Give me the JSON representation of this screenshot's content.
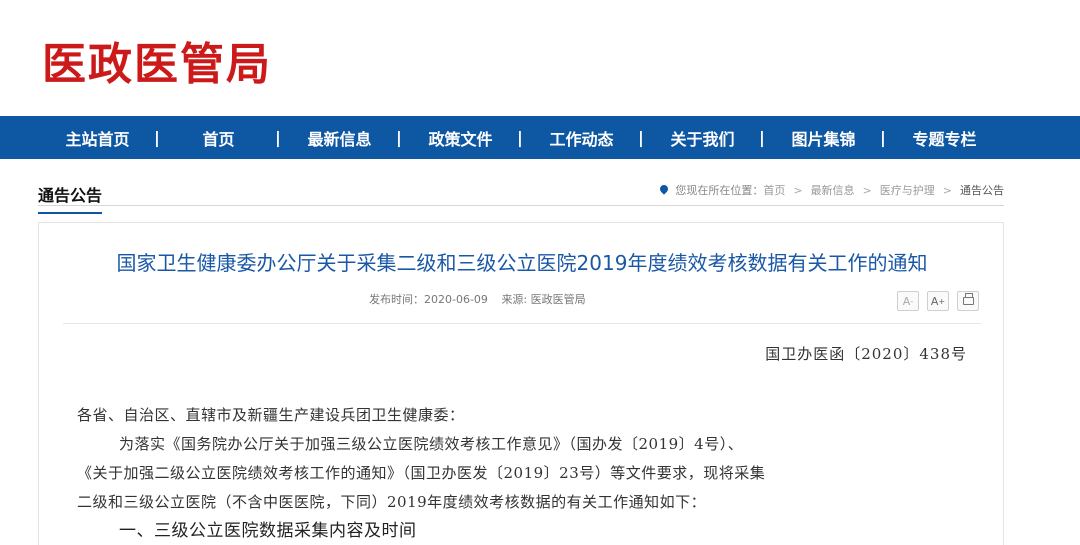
{
  "site": {
    "logo": "医政医管局"
  },
  "nav": {
    "items": [
      "主站首页",
      "首页",
      "最新信息",
      "政策文件",
      "工作动态",
      "关于我们",
      "图片集锦",
      "专题专栏"
    ],
    "separator": "|"
  },
  "section": {
    "title": "通告公告",
    "breadcrumb": {
      "prefix": "您现在所在位置：",
      "items": [
        "首页",
        "最新信息",
        "医疗与护理",
        "通告公告"
      ],
      "separator": ">"
    }
  },
  "article": {
    "title": "国家卫生健康委办公厅关于采集二级和三级公立医院2019年度绩效考核数据有关工作的通知",
    "publish_time": "发布时间：2020-06-09",
    "source": "来源: 医政医管局",
    "tools": {
      "font_smaller": "A",
      "font_larger": "A",
      "print": "print-icon"
    },
    "doc_number": "国卫办医函〔2020〕438号",
    "paragraphs": [
      "各省、自治区、直辖市及新疆生产建设兵团卫生健康委：",
      "为落实《国务院办公厅关于加强三级公立医院绩效考核工作意见》（国办发〔2019〕4号）、",
      "《关于加强二级公立医院绩效考核工作的通知》（国卫办医发〔2019〕23号）等文件要求，现将采集",
      "二级和三级公立医院（不含中医医院，下同）2019年度绩效考核数据的有关工作通知如下：",
      "一、三级公立医院数据采集内容及时间"
    ]
  },
  "colors": {
    "nav_bg": "#0e57a3",
    "logo": "#cc1a1a",
    "title": "#1a58a7"
  }
}
